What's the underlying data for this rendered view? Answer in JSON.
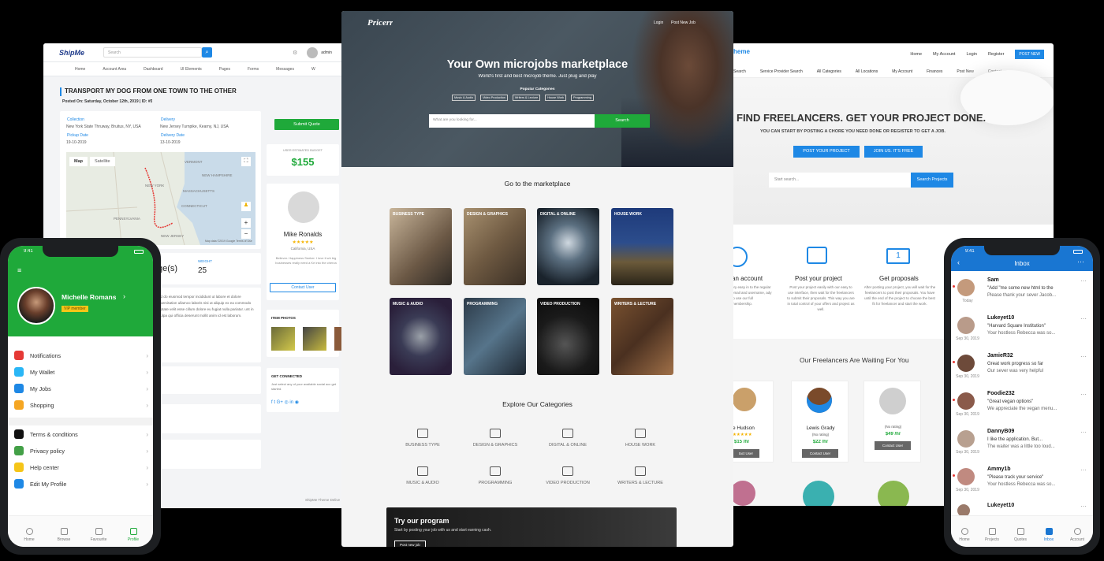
{
  "shipme": {
    "logo": "ShipMe",
    "search_placeholder": "Search",
    "user": "admin",
    "nav": [
      "Home",
      "Account Area",
      "Dashboard",
      "UI Elements",
      "Pages",
      "Forms",
      "Messages",
      "W"
    ],
    "title": "TRANSPORT MY DOG FROM ONE TOWN TO THE OTHER",
    "posted": "Posted On: Saturday, October 12th, 2019 | ID: #5",
    "collection_label": "Collection",
    "collection_addr": "New York State Thruway, Bruitus, NY, USA",
    "delivery_label": "Delivery",
    "delivery_addr": "New Jersey Turnpike, Kearny, NJ, USA",
    "pickup_label": "Pickup Date",
    "pickup_date": "19-10-2019",
    "delivery_date_label": "Delivery Date",
    "delivery_date": "13-10-2019",
    "map_tab": "Map",
    "satellite_tab": "Satellite",
    "map_labels": [
      "VERMONT",
      "NEW HAMPSHIRE",
      "MASSACHUSETTS",
      "CONNECTICUT",
      "NEW YORK",
      "PENNSYLVANIA",
      "NEW JERSEY"
    ],
    "map_footer": "Map data ©2019 Google  Terms of Use",
    "submit_quote": "Submit Quote",
    "budget_label": "USER ESTIMATED BUDGET",
    "budget": "$155",
    "owner_name": "Mike Ronalds",
    "owner_stars": "★★★★★",
    "owner_location": "California, USA",
    "owner_bio": "Believer. Happiness Seeker. I love it wh big businesses really need a Ke into the cherva",
    "contact_user": "Contact User",
    "pages_partial": "ge(s)",
    "weight_label": "WEIGHT",
    "weight": "25",
    "item_photos": "ITEM PHOTOS",
    "get_connected": "GET CONNECTED",
    "get_connected_text": "Just select any of your available social acc get started.",
    "lorem": "ad do eiusmod tempor incididunt ut labore et dolore exercitation ullamco laboris nisi ut aliquip ex ea commodo aptate velit esse cillum dolore eu fugiat nulla pariatur. unt in culpa qui officia deserunt mollit anim id est laborum.",
    "footer": "ShipMe Theme Delive"
  },
  "pricerr": {
    "logo": "Pricerr",
    "login": "Login",
    "post_job": "Post New Job",
    "headline": "Your Own microjobs marketplace",
    "tagline": "World's first and best microjob theme. Just plug and play",
    "popular": "Popular Categories",
    "popular_tags": [
      "Music & Audio",
      "Video Production",
      "Writers & Lecture",
      "House Work",
      "Programming"
    ],
    "search_placeholder": "What are you looking for...",
    "search_button": "Search",
    "marketplace_heading": "Go to the marketplace",
    "tiles": [
      "BUSINESS TYPE",
      "DESIGN & GRAPHICS",
      "DIGITAL & ONLINE",
      "HOUSE WORK",
      "MUSIC & AUDIO",
      "PROGRAMMING",
      "VIDEO PRODUCTION",
      "WRITERS & LECTURE"
    ],
    "explore_heading": "Explore Our Categories",
    "explore": [
      "BUSINESS TYPE",
      "DESIGN & GRAPHICS",
      "DIGITAL & ONLINE",
      "HOUSE WORK",
      "MUSIC & AUDIO",
      "PROGRAMMING",
      "VIDEO PRODUCTION",
      "WRITERS & LECTURE"
    ],
    "promo_title": "Try our program",
    "promo_text": "Start by posting your job with us and start earning cash.",
    "promo_button": "Post new job"
  },
  "freelancer": {
    "logo": "heme",
    "nav": [
      "Home",
      "My Account",
      "Login",
      "Register"
    ],
    "post_new": "POST NEW",
    "subnav": [
      "Search",
      "Service Provider Search",
      "All Categories",
      "All Locations",
      "My Account",
      "Finances",
      "Post New",
      "Contact us"
    ],
    "hero_title": "FIND FREELANCERS. GET YOUR PROJECT DONE.",
    "hero_sub": "YOU CAN START BY POSTING A CHORE YOU NEED DONE OR REGISTER TO GET A JOB.",
    "post_project_btn": "POST YOUR PROJECT",
    "join_btn": "JOIN US. IT'S FREE",
    "search_placeholder": "Start search...",
    "search_btn": "Search Projects",
    "steps": [
      {
        "title": "an account",
        "text": "ery easy in to the regular email and username, ady to use our full membership."
      },
      {
        "title": "Post your project",
        "text": "Post your project easily with our easy to use interface, then wait for the freelancers to submit their proposals. This way you are in total control of your offers and project as well."
      },
      {
        "title": "Get proposals",
        "text": "After posting your project, you will wait for the freelancers to post their proposals. You have until the end of the project to choose the best fit for freelancer and start the work."
      }
    ],
    "waiting_heading": "Our Freelancers Are Waiting For You",
    "cards": [
      {
        "name": "e Hudson",
        "rating": "★★★★★",
        "price": "$15 /hr",
        "btn": "tact User"
      },
      {
        "name": "Lewis Grady",
        "rating": "(No rating)",
        "price": "$22 /hr",
        "btn": "Contact User"
      },
      {
        "name": "(No rating)",
        "rating": "",
        "price": "$49 /hr",
        "btn": "Contact User"
      }
    ]
  },
  "phone_left": {
    "time": "9:41",
    "name": "Michelle Romans",
    "badge": "VIP member",
    "menu1": [
      "Notifications",
      "My Wallet",
      "My Jobs",
      "Shopping"
    ],
    "menu2": [
      "Terms & conditions",
      "Privacy policy",
      "Help center",
      "Edit My Profile"
    ],
    "tabs": [
      "Home",
      "Browse",
      "Favourite",
      "Profile"
    ],
    "accent": "#1fa93a"
  },
  "phone_right": {
    "time": "9:41",
    "title": "Inbox",
    "messages": [
      {
        "name": "Sam",
        "l1": "\"Add \"me some new html to the",
        "l2": "Please thank your sever Jacob...",
        "date": "Today"
      },
      {
        "name": "Lukeyet10",
        "l1": "\"Harvard Square Institution\"",
        "l2": "Your hostless Rebecca was so...",
        "date": "Sep 30, 2019"
      },
      {
        "name": "JamieR32",
        "l1": "Great work progress so far",
        "l2": "Our sever was very helpful",
        "date": "Sep 30, 2019"
      },
      {
        "name": "Foodie232",
        "l1": "\"Great vegan options\"",
        "l2": "We appreciate the vegan menu...",
        "date": "Sep 30, 2019"
      },
      {
        "name": "DannyB09",
        "l1": "I like the application. But...",
        "l2": "The waiter was a little too loud...",
        "date": "Sep 30, 2019"
      },
      {
        "name": "Ammy1b",
        "l1": "\"Please track your service\"",
        "l2": "Your hostless Rebecca was so...",
        "date": "Sep 30, 2019"
      },
      {
        "name": "Lukeyet10",
        "l1": "",
        "l2": "",
        "date": ""
      }
    ],
    "tabs": [
      "Home",
      "Projects",
      "Quotes",
      "Inbox",
      "Account"
    ],
    "accent": "#1976d2"
  }
}
